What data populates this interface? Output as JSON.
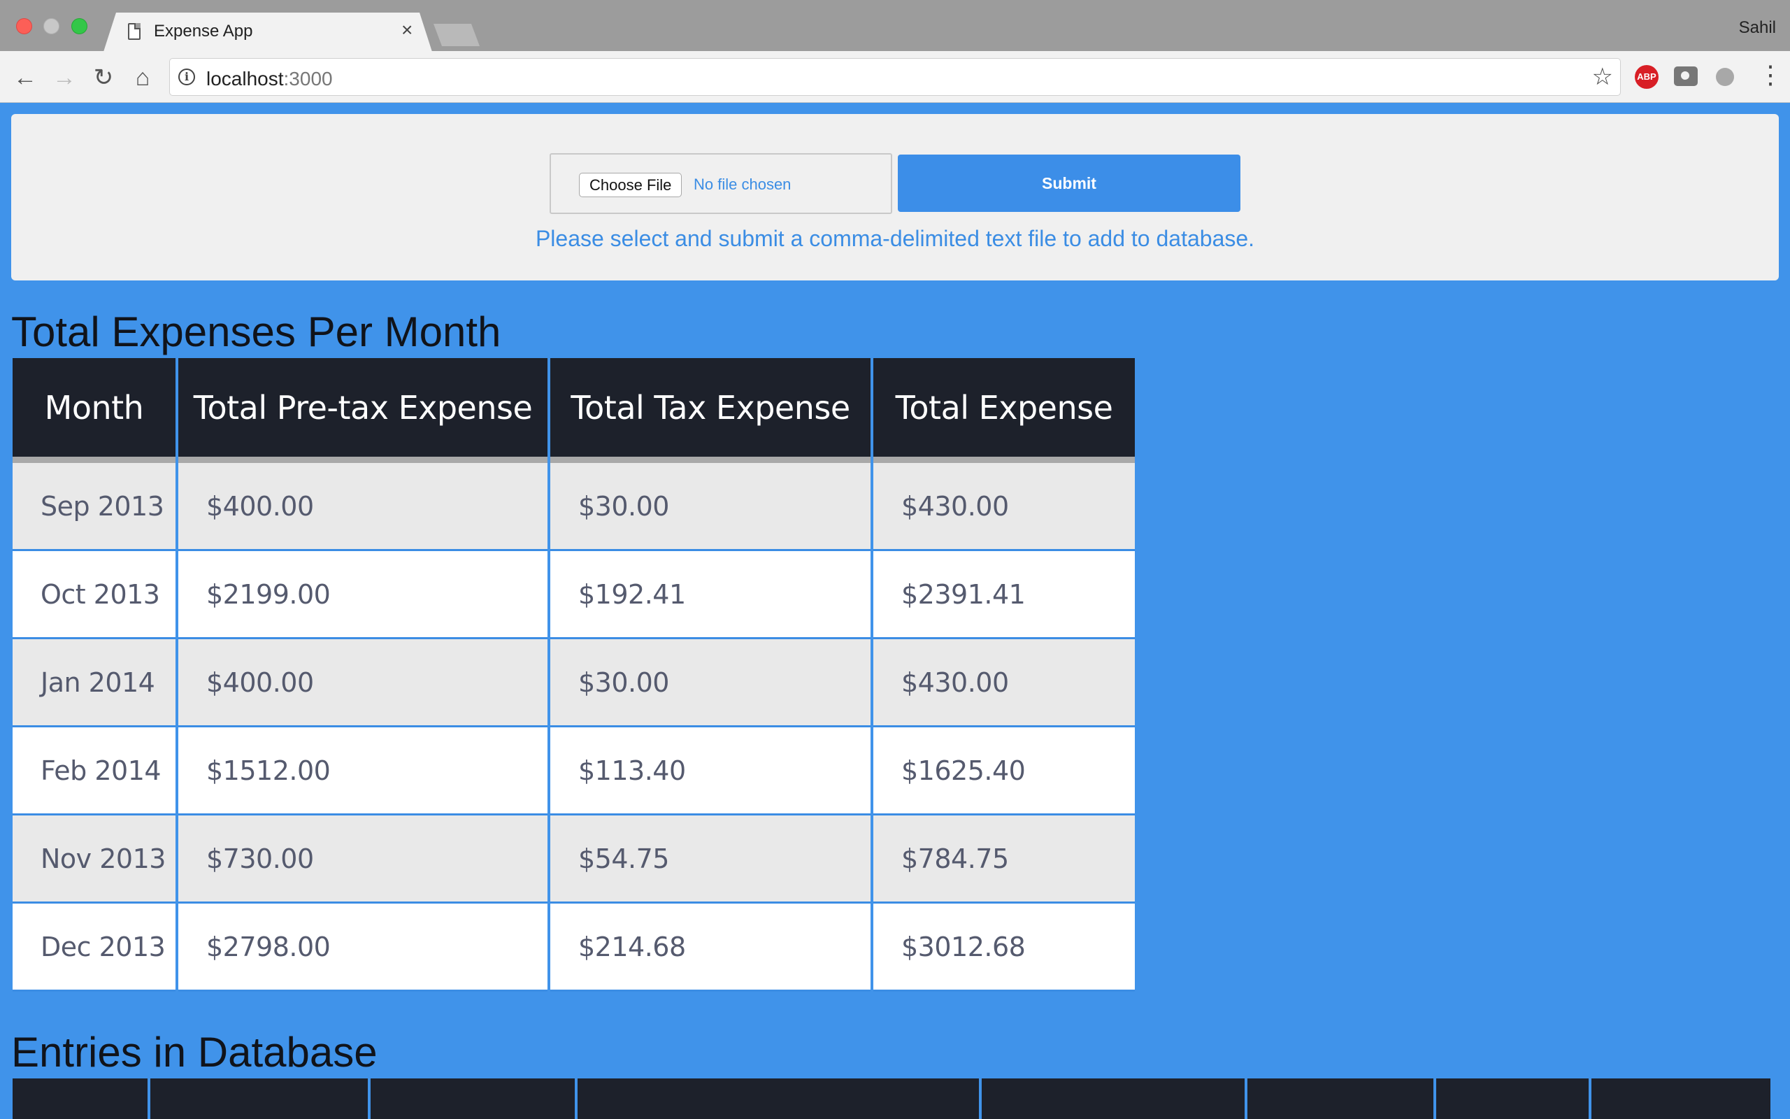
{
  "browser": {
    "tab_title": "Expense App",
    "tab_close": "×",
    "profile_name": "Sahil",
    "url_host": "localhost",
    "url_port": ":3000",
    "extension_abp": "ABP"
  },
  "upload": {
    "choose_file_label": "Choose File",
    "no_file_text": "No file chosen",
    "submit_label": "Submit",
    "hint": "Please select and submit a comma-delimited text file to add to database."
  },
  "summary": {
    "title": "Total Expenses Per Month",
    "headers": [
      "Month",
      "Total Pre-tax Expense",
      "Total Tax Expense",
      "Total Expense"
    ],
    "rows": [
      [
        "Sep 2013",
        "$400.00",
        "$30.00",
        "$430.00"
      ],
      [
        "Oct 2013",
        "$2199.00",
        "$192.41",
        "$2391.41"
      ],
      [
        "Jan 2014",
        "$400.00",
        "$30.00",
        "$430.00"
      ],
      [
        "Feb 2014",
        "$1512.00",
        "$113.40",
        "$1625.40"
      ],
      [
        "Nov 2013",
        "$730.00",
        "$54.75",
        "$784.75"
      ],
      [
        "Dec 2013",
        "$2798.00",
        "$214.68",
        "$3012.68"
      ]
    ]
  },
  "entries": {
    "title": "Entries in Database"
  },
  "colors": {
    "page_background": "#4093ea",
    "table_header": "#1d212b",
    "accent_text": "#3b8de4",
    "submit_button": "#3c8ee8"
  }
}
